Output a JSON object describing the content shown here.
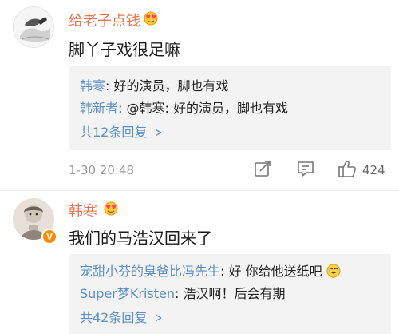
{
  "comments": [
    {
      "username": "给老子点钱",
      "text": "脚丫子戏很足嘛",
      "replies": [
        {
          "user": "韩寒",
          "sep": ": ",
          "text": "好的演员，脚也有戏"
        },
        {
          "user": "韩新者",
          "sep": ": ",
          "text": "@韩寒: 好的演员，脚也有戏"
        }
      ],
      "more_replies": "共12条回复",
      "timestamp": "1-30 20:48",
      "like_count": "424"
    },
    {
      "username": "韩寒",
      "badge": "V",
      "text": "我们的马浩汉回来了",
      "replies": [
        {
          "user": "宠甜小芬的臭爸比冯先生",
          "sep": ": ",
          "text": "好 你给他送纸吧"
        },
        {
          "user": "Super梦Kristen",
          "sep": ": ",
          "text": "浩汉啊！后会有期"
        }
      ],
      "more_replies": "共42条回复"
    }
  ],
  "icons": {
    "fan_badge": "heart-eyes-fan-icon",
    "share": "share-edit-icon",
    "comment": "comment-icon",
    "like": "thumbs-up-icon"
  },
  "colors": {
    "username": "#eb7350",
    "link": "#5b8fc5",
    "meta": "#9a9a9a",
    "reply_bg": "#f3f3f3",
    "badge": "#ff8a00"
  }
}
